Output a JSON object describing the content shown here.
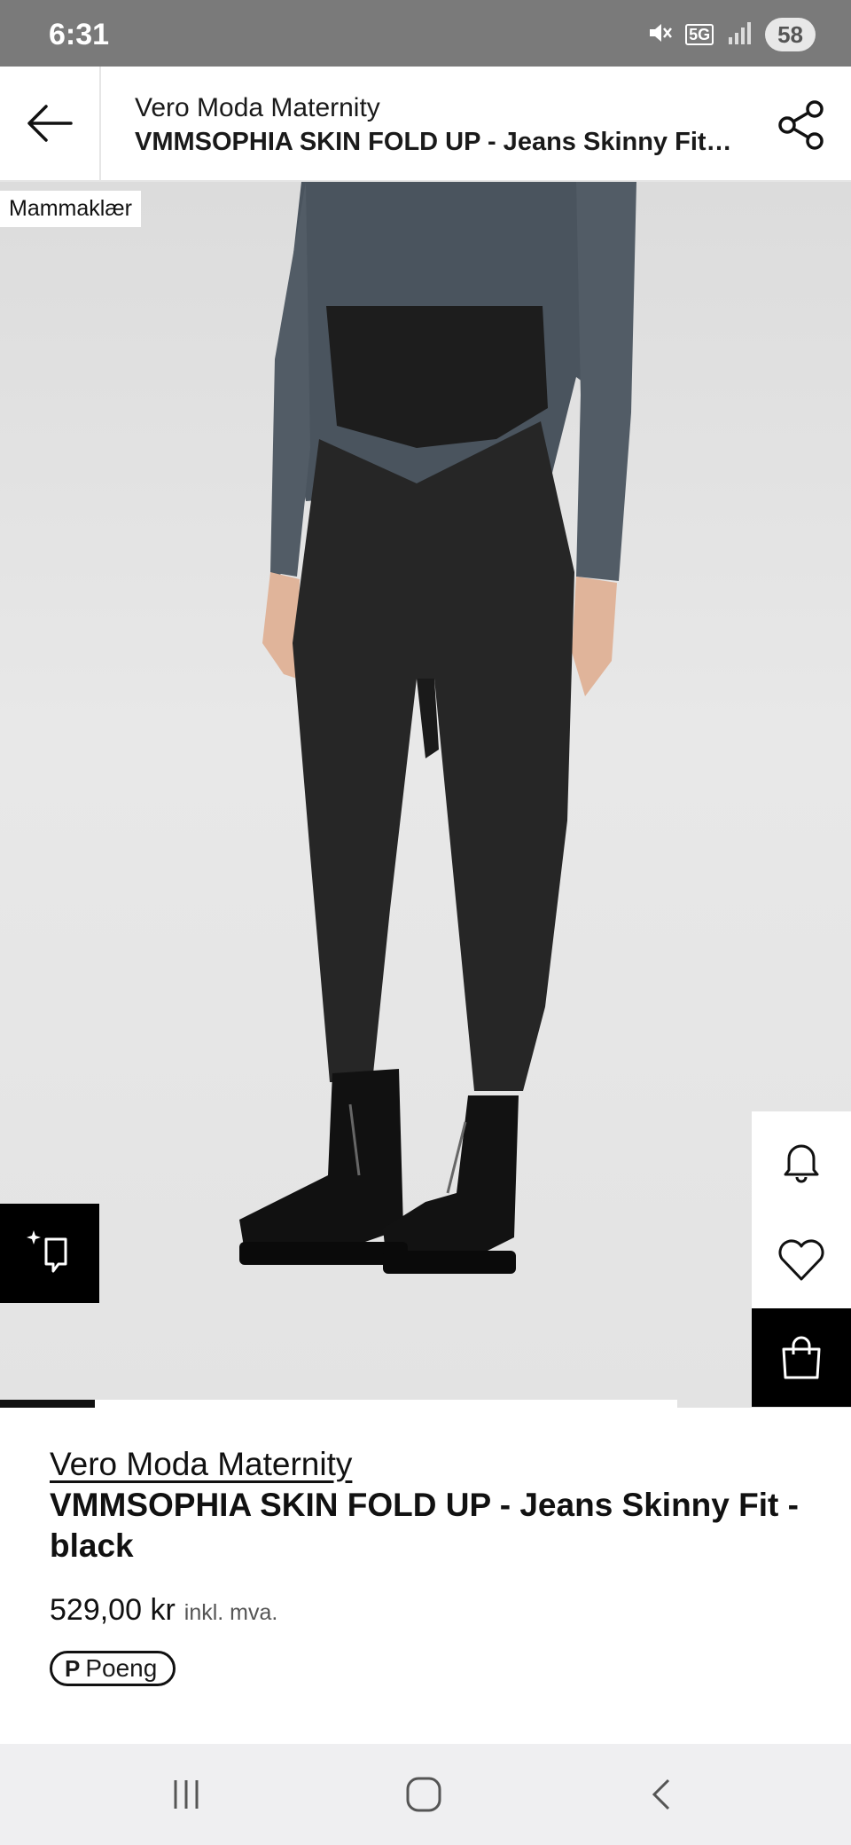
{
  "status_bar": {
    "time": "6:31",
    "network": "5G",
    "battery": "58",
    "icons": [
      "mute-icon",
      "5g-icon",
      "signal-icon",
      "battery-icon"
    ]
  },
  "app_bar": {
    "brand": "Vero Moda Maternity",
    "product": "VMMSOPHIA SKIN FOLD UP  - Jeans Skinny Fit - black",
    "back_icon": "arrow-left-icon",
    "share_icon": "share-icon"
  },
  "image": {
    "tag": "Mammaklær",
    "side_actions": [
      "bell-icon",
      "heart-icon",
      "bag-icon"
    ],
    "compare_icon": "sparkle-compare-icon",
    "carousel_progress": 0.14
  },
  "product": {
    "brand": "Vero Moda Maternity",
    "name": "VMMSOPHIA SKIN FOLD UP  - Jeans Skinny Fit - black",
    "price": "529,00 kr",
    "vat": "inkl. mva.",
    "points_symbol": "P",
    "points_label": "Poeng"
  },
  "nav_bar": {
    "buttons": [
      "recent-apps-icon",
      "home-icon",
      "back-icon"
    ]
  }
}
